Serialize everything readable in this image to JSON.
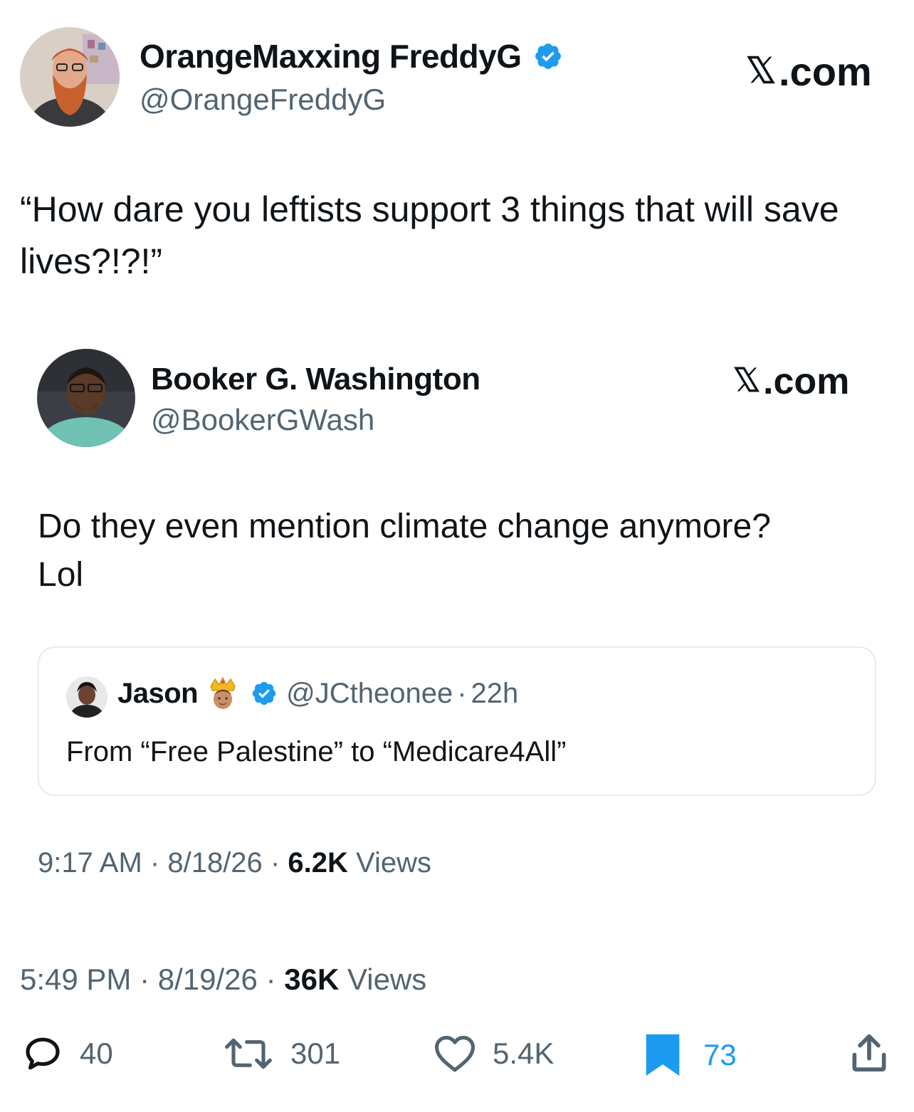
{
  "main_tweet": {
    "author_name": "OrangeMaxxing FreddyG",
    "author_handle": "@OrangeFreddyG",
    "brand": ".com",
    "text": "“How dare you leftists support 3 things that will save lives?!?!”",
    "time": "5:49 PM",
    "date": "8/19/26",
    "views_count": "36K",
    "views_label": "Views"
  },
  "quoted_tweet": {
    "author_name": "Booker G. Washington",
    "author_handle": "@BookerGWash",
    "brand": ".com",
    "text_line1": "Do they even mention climate change anymore?",
    "text_line2": "Lol",
    "time": "9:17 AM",
    "date": "8/18/26",
    "views_count": "6.2K",
    "views_label": "Views"
  },
  "nested_quote": {
    "author_name": "Jason",
    "author_handle": "@JCtheonee",
    "age": "22h",
    "text": "From “Free Palestine” to “Medicare4All”"
  },
  "separator": "·",
  "actions": {
    "replies": "40",
    "reposts": "301",
    "likes": "5.4K",
    "bookmarks": "73"
  },
  "colors": {
    "verified": "#1d9bf0",
    "bookmark_active": "#1d9bf0",
    "text_primary": "#0f1419",
    "text_secondary": "#536471"
  }
}
